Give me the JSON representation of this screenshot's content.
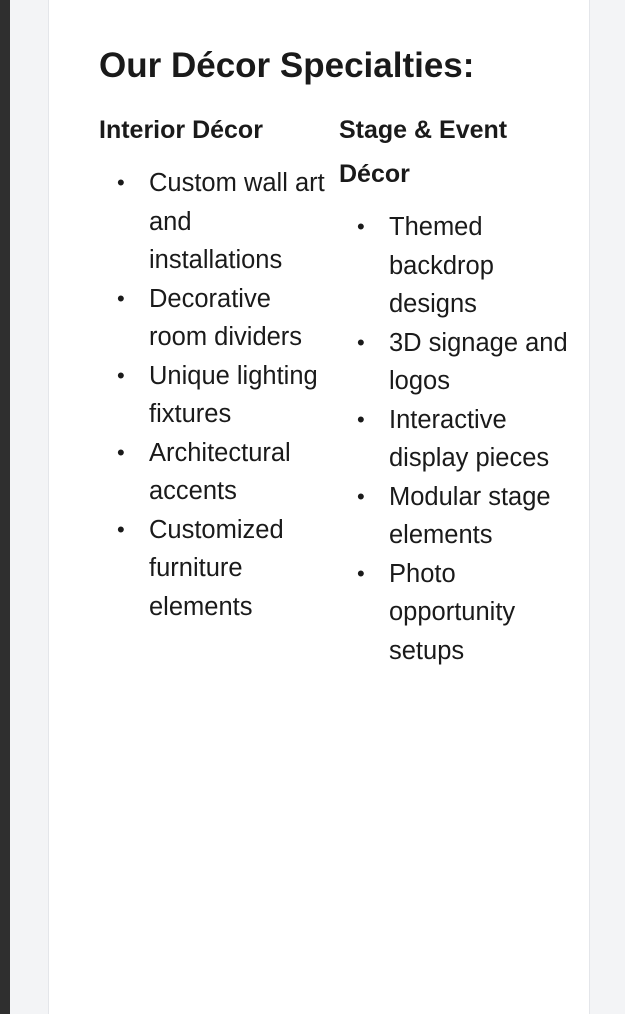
{
  "section": {
    "heading": "Our Décor Specialties:"
  },
  "columns": [
    {
      "title": "Interior Décor",
      "items": [
        "Custom wall art and installations",
        "Decorative room dividers",
        "Unique lighting fixtures",
        "Architectural accents",
        "Customized furniture elements"
      ]
    },
    {
      "title": "Stage & Event Décor",
      "items": [
        "Themed backdrop designs",
        "3D signage and logos",
        "Interactive display pieces",
        "Modular stage elements",
        "Photo opportunity setups"
      ]
    }
  ]
}
